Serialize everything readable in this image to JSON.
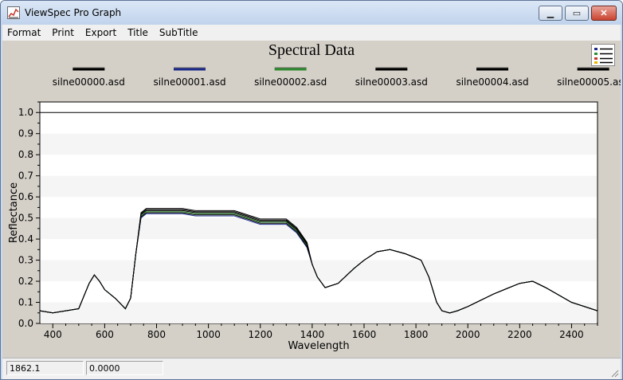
{
  "window": {
    "title": "ViewSpec Pro Graph",
    "minimize_icon": "minimize-icon",
    "maximize_icon": "maximize-icon",
    "close_icon": "close-icon",
    "min_glyph": "▁",
    "max_glyph": "▭",
    "close_glyph": "✕"
  },
  "menu": [
    "Format",
    "Print",
    "Export",
    "Title",
    "SubTitle"
  ],
  "status": {
    "cursor_x": "1862.1",
    "cursor_y": "0.0000"
  },
  "colors": {
    "window_bg": "#c9d9ee",
    "plot_bg_light": "#ffffff",
    "plot_bg_band": "#f5f5f5",
    "graph_panel": "#d4d0c8"
  },
  "chart_data": {
    "type": "line",
    "title": "Spectral Data",
    "xlabel": "Wavelength",
    "ylabel": "Reflectance",
    "xlim": [
      350,
      2500
    ],
    "ylim": [
      0,
      1.05
    ],
    "xticks": [
      400,
      600,
      800,
      1000,
      1200,
      1400,
      1600,
      1800,
      2000,
      2200,
      2400
    ],
    "yticks": [
      "0.0",
      "0.1",
      "0.2",
      "0.3",
      "0.4",
      "0.5",
      "0.6",
      "0.7",
      "0.8",
      "0.9",
      "1.0"
    ],
    "legend_position": "top",
    "grid": "horizontal bands",
    "reference_line": {
      "y": 1.0,
      "color": "#000000"
    },
    "base_x": [
      350,
      400,
      450,
      500,
      540,
      560,
      580,
      600,
      640,
      680,
      700,
      720,
      740,
      760,
      800,
      900,
      950,
      1000,
      1100,
      1150,
      1200,
      1300,
      1340,
      1380,
      1400,
      1420,
      1450,
      1500,
      1560,
      1600,
      1650,
      1700,
      1760,
      1800,
      1820,
      1850,
      1880,
      1900,
      1930,
      1960,
      2000,
      2100,
      2200,
      2250,
      2300,
      2400,
      2500
    ],
    "series": [
      {
        "name": "silne00000.asd",
        "color": "#000000",
        "offset": 0.01,
        "values": [
          0.06,
          0.05,
          0.06,
          0.07,
          0.19,
          0.23,
          0.2,
          0.16,
          0.12,
          0.07,
          0.12,
          0.33,
          0.51,
          0.53,
          0.53,
          0.53,
          0.52,
          0.52,
          0.52,
          0.5,
          0.48,
          0.48,
          0.44,
          0.37,
          0.28,
          0.22,
          0.17,
          0.19,
          0.26,
          0.3,
          0.34,
          0.35,
          0.33,
          0.31,
          0.3,
          0.22,
          0.1,
          0.06,
          0.05,
          0.06,
          0.08,
          0.14,
          0.19,
          0.2,
          0.17,
          0.1,
          0.06
        ]
      },
      {
        "name": "silne00001.asd",
        "color": "#1c2a8c",
        "offset": -0.01,
        "values": [
          0.06,
          0.05,
          0.06,
          0.07,
          0.19,
          0.23,
          0.2,
          0.16,
          0.12,
          0.07,
          0.12,
          0.33,
          0.51,
          0.53,
          0.53,
          0.53,
          0.52,
          0.52,
          0.52,
          0.5,
          0.48,
          0.48,
          0.44,
          0.37,
          0.28,
          0.22,
          0.17,
          0.19,
          0.26,
          0.3,
          0.34,
          0.35,
          0.33,
          0.31,
          0.3,
          0.22,
          0.1,
          0.06,
          0.05,
          0.06,
          0.08,
          0.14,
          0.19,
          0.2,
          0.17,
          0.1,
          0.06
        ]
      },
      {
        "name": "silne00002.asd",
        "color": "#2e8b2e",
        "offset": 0.0,
        "values": [
          0.06,
          0.05,
          0.06,
          0.07,
          0.19,
          0.23,
          0.2,
          0.16,
          0.12,
          0.07,
          0.12,
          0.33,
          0.51,
          0.53,
          0.53,
          0.53,
          0.52,
          0.52,
          0.52,
          0.5,
          0.48,
          0.48,
          0.44,
          0.37,
          0.28,
          0.22,
          0.17,
          0.19,
          0.26,
          0.3,
          0.34,
          0.35,
          0.33,
          0.31,
          0.3,
          0.22,
          0.1,
          0.06,
          0.05,
          0.06,
          0.08,
          0.14,
          0.19,
          0.2,
          0.17,
          0.1,
          0.06
        ]
      },
      {
        "name": "silne00003.asd",
        "color": "#000000",
        "offset": 0.005,
        "values": [
          0.06,
          0.05,
          0.06,
          0.07,
          0.19,
          0.23,
          0.2,
          0.16,
          0.12,
          0.07,
          0.12,
          0.33,
          0.51,
          0.53,
          0.53,
          0.53,
          0.52,
          0.52,
          0.52,
          0.5,
          0.48,
          0.48,
          0.44,
          0.37,
          0.28,
          0.22,
          0.17,
          0.19,
          0.26,
          0.3,
          0.34,
          0.35,
          0.33,
          0.31,
          0.3,
          0.22,
          0.1,
          0.06,
          0.05,
          0.06,
          0.08,
          0.14,
          0.19,
          0.2,
          0.17,
          0.1,
          0.06
        ]
      },
      {
        "name": "silne00004.asd",
        "color": "#000000",
        "offset": 0.015,
        "values": [
          0.06,
          0.05,
          0.06,
          0.07,
          0.19,
          0.23,
          0.2,
          0.16,
          0.12,
          0.07,
          0.12,
          0.33,
          0.51,
          0.53,
          0.53,
          0.53,
          0.52,
          0.52,
          0.52,
          0.5,
          0.48,
          0.48,
          0.44,
          0.37,
          0.28,
          0.22,
          0.17,
          0.19,
          0.26,
          0.3,
          0.34,
          0.35,
          0.33,
          0.31,
          0.3,
          0.22,
          0.1,
          0.06,
          0.05,
          0.06,
          0.08,
          0.14,
          0.19,
          0.2,
          0.17,
          0.1,
          0.06
        ]
      },
      {
        "name": "silne00005.asd",
        "color": "#000000",
        "offset": -0.005,
        "values": [
          0.06,
          0.05,
          0.06,
          0.07,
          0.19,
          0.23,
          0.2,
          0.16,
          0.12,
          0.07,
          0.12,
          0.33,
          0.51,
          0.53,
          0.53,
          0.53,
          0.52,
          0.52,
          0.52,
          0.5,
          0.48,
          0.48,
          0.44,
          0.37,
          0.28,
          0.22,
          0.17,
          0.19,
          0.26,
          0.3,
          0.34,
          0.35,
          0.33,
          0.31,
          0.3,
          0.22,
          0.1,
          0.06,
          0.05,
          0.06,
          0.08,
          0.14,
          0.19,
          0.2,
          0.17,
          0.1,
          0.06
        ]
      }
    ]
  }
}
